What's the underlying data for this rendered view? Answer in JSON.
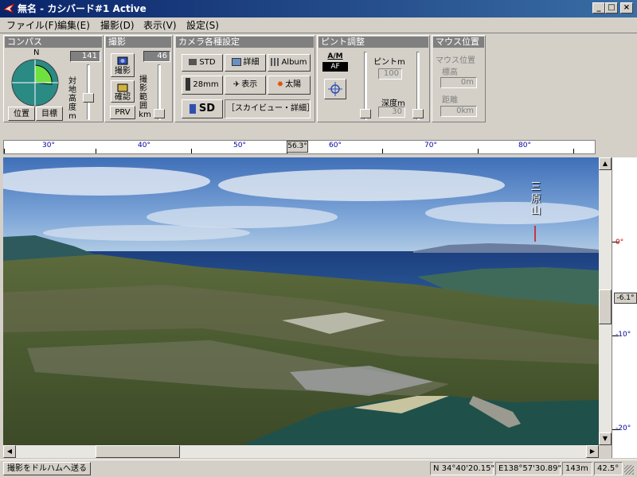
{
  "window": {
    "title": "無名 - カシバード#1  Active",
    "minimize": "_",
    "maximize": "□",
    "close": "×"
  },
  "menu": [
    "ファイル(F)",
    "編集(E)",
    "撮影(D)",
    "表示(V)",
    "設定(S)"
  ],
  "compass": {
    "title": "コンパス",
    "north": "N",
    "height_value": "141",
    "height_label": [
      "対",
      "地",
      "高",
      "度",
      "m"
    ],
    "pos_btn": "位置",
    "target_btn": "目標"
  },
  "shoot": {
    "title": "撮影",
    "range_value": "46",
    "shoot_btn": "撮影",
    "confirm_btn": "確認",
    "prv_btn": "PRV",
    "range_label": [
      "撮",
      "影",
      "範",
      "囲",
      "km"
    ]
  },
  "camera": {
    "title": "カメラ各種設定",
    "std": "STD",
    "detail": "詳細",
    "album": "Album",
    "mm28": "28mm",
    "display": "表示",
    "sun": "太陽",
    "sd": "SD",
    "sky_status": "［スカイビュー・詳細］"
  },
  "focus": {
    "title": "ピント調整",
    "am": "A/M",
    "af": "AF",
    "focus_label": "ピントm",
    "focus_value": "100",
    "depth_label": "深度m",
    "depth_value": "30"
  },
  "mouse": {
    "title": "マウス位置",
    "pos_label": "マウス位置",
    "alt_label": "標高",
    "alt_value": "0m",
    "dist_label": "距離",
    "dist_value": "0km"
  },
  "ruler": {
    "ticks": [
      "30°",
      "40°",
      "50°",
      "60°",
      "70°",
      "80°"
    ],
    "heading": "56.3°"
  },
  "scene": {
    "peak_label": "三原山"
  },
  "pitch": {
    "ticks": [
      "0°",
      "-10°",
      "-20°"
    ],
    "marker": "-6.1°"
  },
  "status": {
    "message": "撮影をドルハムへ送る",
    "lat": "N 34°40'20.15\"",
    "lon": "E138°57'30.89\"",
    "alt": "143m",
    "fov": "42.5°"
  },
  "colors": {
    "titlebar": "#0a246a",
    "panel": "#d4d0c8",
    "panel_header": "#808080",
    "sky": "#6a9fd8",
    "sea": "#1f4e8c",
    "compass_face": "#2a8a84",
    "compass_sector": "#70e040"
  }
}
